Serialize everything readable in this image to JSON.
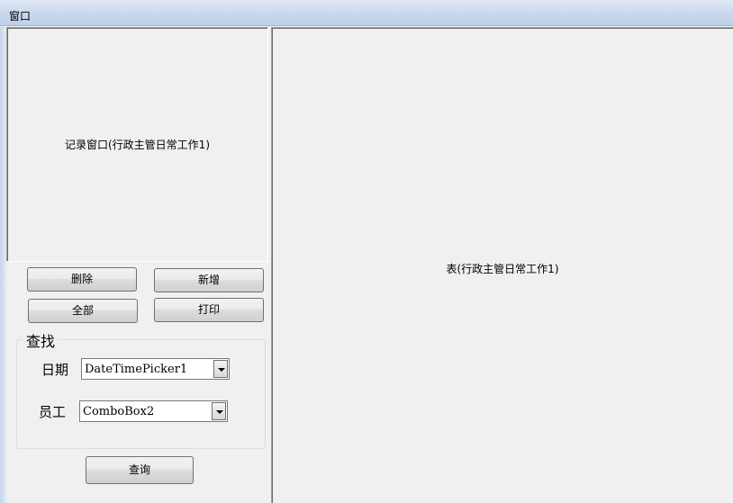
{
  "window": {
    "title": "窗口"
  },
  "record_window": {
    "label": "记录窗口(行政主管日常工作1)"
  },
  "table_panel": {
    "label": "表(行政主管日常工作1)"
  },
  "buttons": {
    "delete": "删除",
    "add": "新增",
    "all": "全部",
    "print": "打印",
    "query": "查询"
  },
  "search_group": {
    "title": "查找",
    "date_label": "日期",
    "date_value": "DateTimePicker1",
    "employee_label": "员工",
    "employee_value": "ComboBox2"
  }
}
